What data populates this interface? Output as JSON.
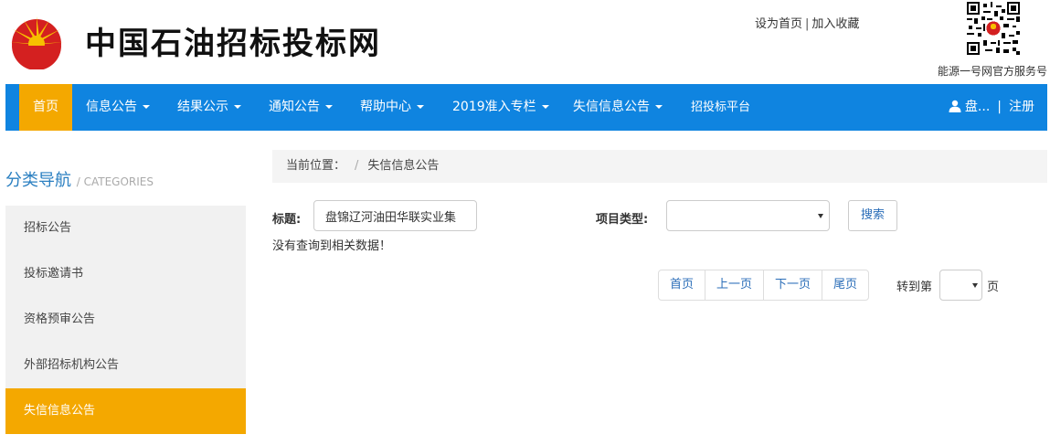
{
  "header": {
    "site_title": "中国石油招标投标网",
    "top_links": [
      "设为首页",
      "加入收藏"
    ],
    "qr_caption": "能源一号网官方服务号",
    "colors": {
      "logo_red": "#d42020",
      "logo_yellow": "#f7c000"
    }
  },
  "nav": {
    "items": [
      {
        "label": "首页",
        "dropdown": false,
        "active": true
      },
      {
        "label": "信息公告",
        "dropdown": true,
        "active": false
      },
      {
        "label": "结果公示",
        "dropdown": true,
        "active": false
      },
      {
        "label": "通知公告",
        "dropdown": true,
        "active": false
      },
      {
        "label": "帮助中心",
        "dropdown": true,
        "active": false
      },
      {
        "label": "2019准入专栏",
        "dropdown": true,
        "active": false
      },
      {
        "label": "失信信息公告",
        "dropdown": true,
        "active": false
      },
      {
        "label": "招投标平台",
        "dropdown": false,
        "active": false
      }
    ],
    "user_label": "盘...",
    "register_label": "注册",
    "user_icon": "user-icon",
    "colors": {
      "bar": "#0f84e0",
      "active": "#f4a800"
    }
  },
  "sidebar": {
    "title": "分类导航",
    "subtitle": "/ CATEGORIES",
    "items": [
      {
        "label": "招标公告",
        "active": false
      },
      {
        "label": "投标邀请书",
        "active": false
      },
      {
        "label": "资格预审公告",
        "active": false
      },
      {
        "label": "外部招标机构公告",
        "active": false
      },
      {
        "label": "失信信息公告",
        "active": true
      }
    ]
  },
  "breadcrumb": {
    "prefix": "当前位置：",
    "separator": "/",
    "current": "失信信息公告"
  },
  "search": {
    "title_label": "标题:",
    "title_value": "盘锦辽河油田华联实业集",
    "type_label": "项目类型:",
    "type_value": "",
    "button_label": "搜索"
  },
  "result": {
    "message": "没有查询到相关数据！"
  },
  "pager": {
    "first": "首页",
    "prev": "上一页",
    "next": "下一页",
    "last": "尾页",
    "goto_label": "转到第",
    "goto_value": "",
    "page_unit": "页"
  }
}
